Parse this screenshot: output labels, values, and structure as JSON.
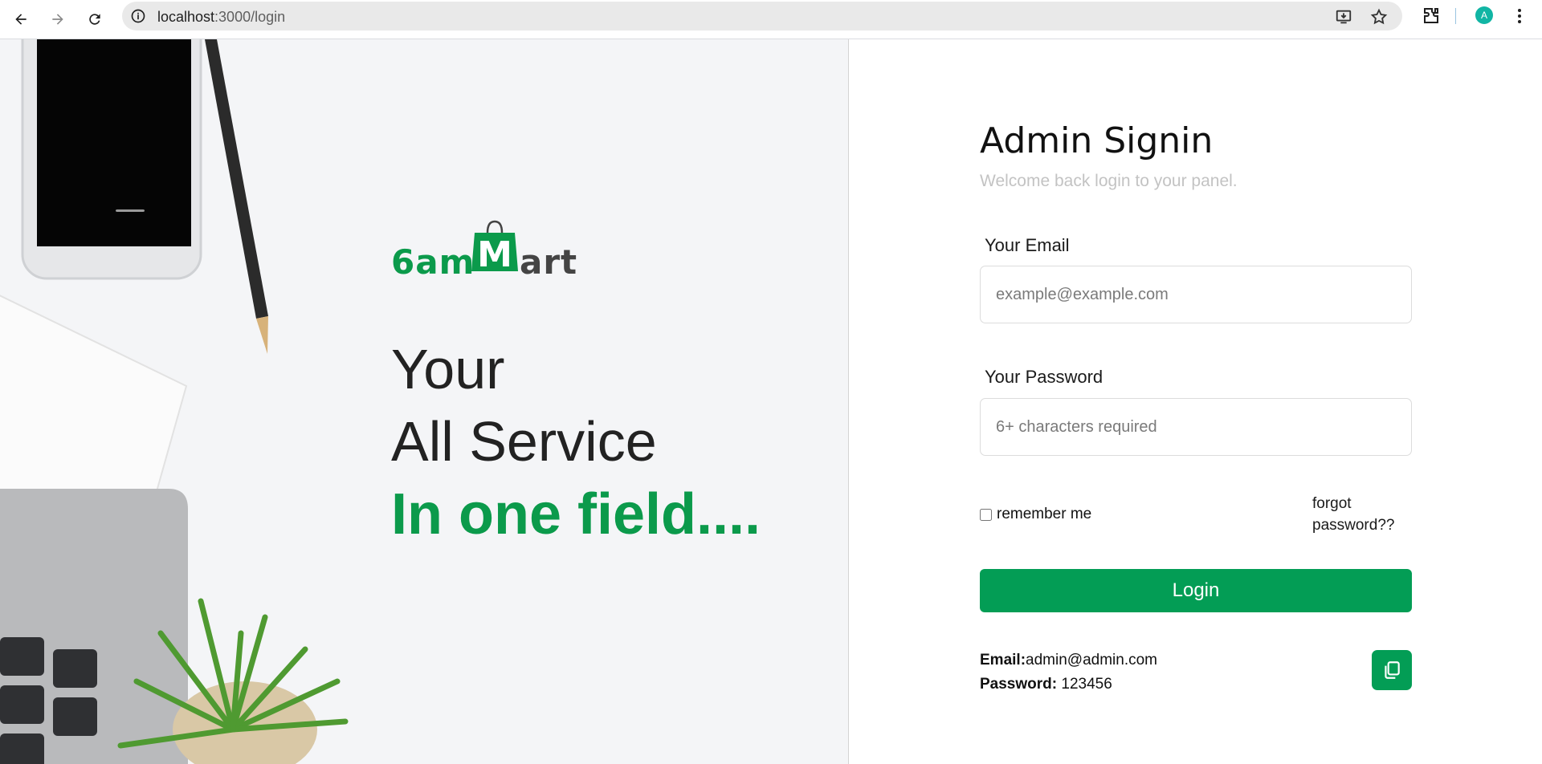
{
  "browser": {
    "url_host": "localhost",
    "url_path": ":3000/login"
  },
  "hero": {
    "logo_part1": "6am",
    "logo_part2": "M",
    "logo_part3": "art",
    "line1": "Your",
    "line2": "All Service",
    "line3": "In one field...."
  },
  "login": {
    "title": "Admin Signin",
    "subtitle": "Welcome back login to your panel.",
    "email_label": "Your Email",
    "email_placeholder": "example@example.com",
    "password_label": "Your Password",
    "password_placeholder": "6+ characters required",
    "remember_label": "remember me",
    "forgot_label": "forgot password??",
    "login_button": "Login"
  },
  "credentials": {
    "email_key": "Email:",
    "email_value": "admin@admin.com",
    "password_key": "Password:",
    "password_value": "123456"
  },
  "colors": {
    "brand_green": "#039d55",
    "avatar_teal": "#11b5a4"
  },
  "profile": {
    "avatar_letter": "A"
  }
}
